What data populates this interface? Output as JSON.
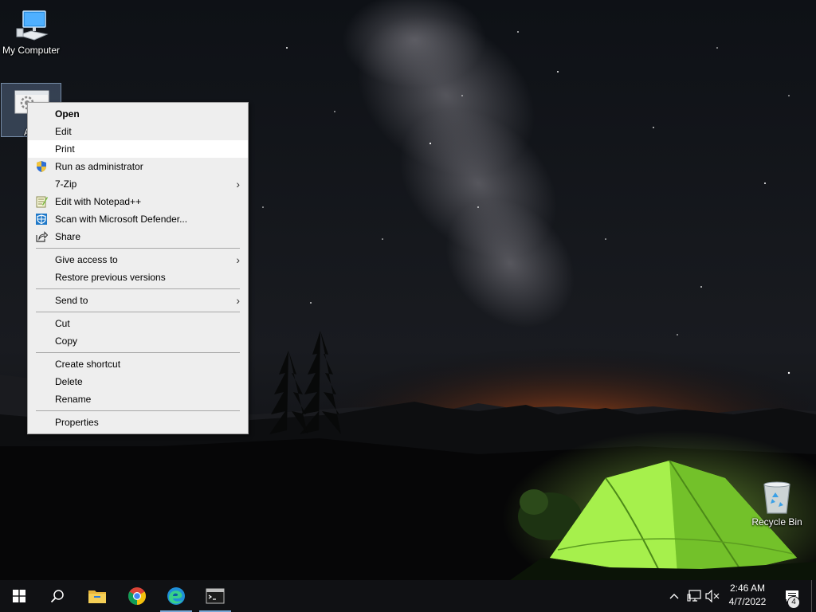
{
  "desktop": {
    "icons": {
      "my_computer": "My Computer",
      "selected_file": "A",
      "recycle_bin": "Recycle Bin"
    }
  },
  "context_menu": {
    "items": {
      "open": "Open",
      "edit": "Edit",
      "print": "Print",
      "run_as_admin": "Run as administrator",
      "seven_zip": "7-Zip",
      "edit_notepadpp": "Edit with Notepad++",
      "scan_defender": "Scan with Microsoft Defender...",
      "share": "Share",
      "give_access": "Give access to",
      "restore_versions": "Restore previous versions",
      "send_to": "Send to",
      "cut": "Cut",
      "copy": "Copy",
      "create_shortcut": "Create shortcut",
      "delete": "Delete",
      "rename": "Rename",
      "properties": "Properties"
    },
    "hovered_item": "print",
    "submenu_arrow": "›"
  },
  "taskbar": {
    "apps": [
      "start-icon",
      "search-icon",
      "file-explorer-icon",
      "chrome-icon",
      "edge-icon",
      "terminal-icon"
    ],
    "clock": {
      "time": "2:46 AM",
      "date": "4/7/2022"
    },
    "notification_count": "4"
  },
  "colors": {
    "menu_bg": "#eeeeee",
    "menu_hover": "#ffffff",
    "taskbar_bg": "#101114",
    "accent": "#0078d7",
    "tent_green": "#8fe23a",
    "horizon_glow": "#e8631c"
  }
}
